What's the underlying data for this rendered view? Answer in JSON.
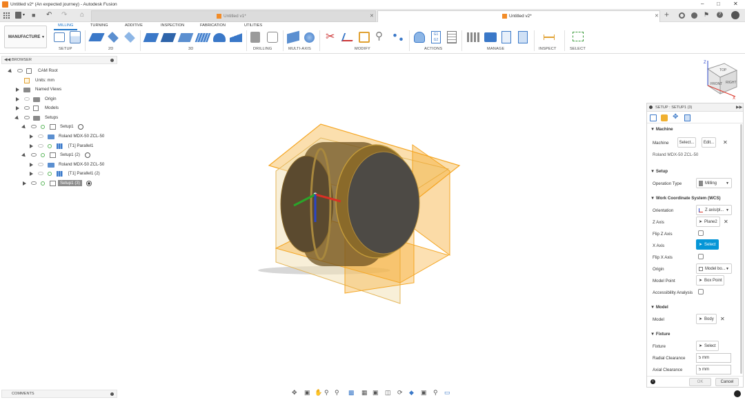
{
  "window": {
    "title": "Untitled v2* (An expected journey) - Autodesk Fusion"
  },
  "tabs": [
    {
      "label": "Untitled v1*"
    },
    {
      "label": "Untitled v2*"
    }
  ],
  "workspace": {
    "label": "MANUFACTURE"
  },
  "ribbon_tabs": [
    "MILLING",
    "TURNING",
    "ADDITIVE",
    "INSPECTION",
    "FABRICATION",
    "UTILITIES"
  ],
  "ribbon_groups": [
    "SETUP",
    "2D",
    "3D",
    "DRILLING",
    "MULTI-AXIS",
    "MODIFY",
    "ACTIONS",
    "MANAGE",
    "INSPECT",
    "SELECT"
  ],
  "browser": {
    "title": "BROWSER",
    "items": [
      {
        "label": "CAM Root"
      },
      {
        "label": "Units: mm"
      },
      {
        "label": "Named Views"
      },
      {
        "label": "Origin"
      },
      {
        "label": "Models"
      },
      {
        "label": "Setups"
      },
      {
        "label": "Setup1"
      },
      {
        "label": "Roland MDX-50 ZCL-50"
      },
      {
        "label": "[T1] Parallel1"
      },
      {
        "label": "Setup1 (2)"
      },
      {
        "label": "Roland MDX-50 ZCL-50"
      },
      {
        "label": "[T1] Parallel1 (2)"
      },
      {
        "label": "Setup1 (3)"
      }
    ]
  },
  "comments": {
    "label": "COMMENTS"
  },
  "viewcube": {
    "top": "TOP",
    "front": "FRONT",
    "right": "RIGHT"
  },
  "setup_panel": {
    "title": "SETUP : SETUP1 (3)",
    "machine": {
      "heading": "Machine",
      "label": "Machine",
      "select_btn": "Select...",
      "edit_btn": "Edit...",
      "name": "Roland MDX-50 ZCL-50"
    },
    "setup": {
      "heading": "Setup",
      "op_type_label": "Operation Type",
      "op_type_value": "Milling"
    },
    "wcs": {
      "heading": "Work Coordinate System (WCS)",
      "orientation_label": "Orientation",
      "orientation_value": "Z axis/pl...",
      "z_axis_label": "Z Axis",
      "z_axis_value": "Plane2",
      "flip_z_label": "Flip Z Axis",
      "x_axis_label": "X Axis",
      "x_axis_value": "Select",
      "flip_x_label": "Flip X Axis",
      "origin_label": "Origin",
      "origin_value": "Model bo...",
      "model_point_label": "Model Point",
      "model_point_value": "Box Point",
      "accessibility_label": "Accessibility Analysis"
    },
    "model": {
      "heading": "Model",
      "label": "Model",
      "value": "Body"
    },
    "fixture": {
      "heading": "Fixture",
      "label": "Fixture",
      "value": "Select",
      "radial_label": "Radial Clearance",
      "radial_value": "5 mm",
      "axial_label": "Axial Clearance",
      "axial_value": "5 mm"
    },
    "ok": "OK",
    "cancel": "Cancel"
  },
  "colors": {
    "accent": "#0696d7",
    "stock": "#f5a623",
    "ribbon_blue": "#1a73c8"
  }
}
